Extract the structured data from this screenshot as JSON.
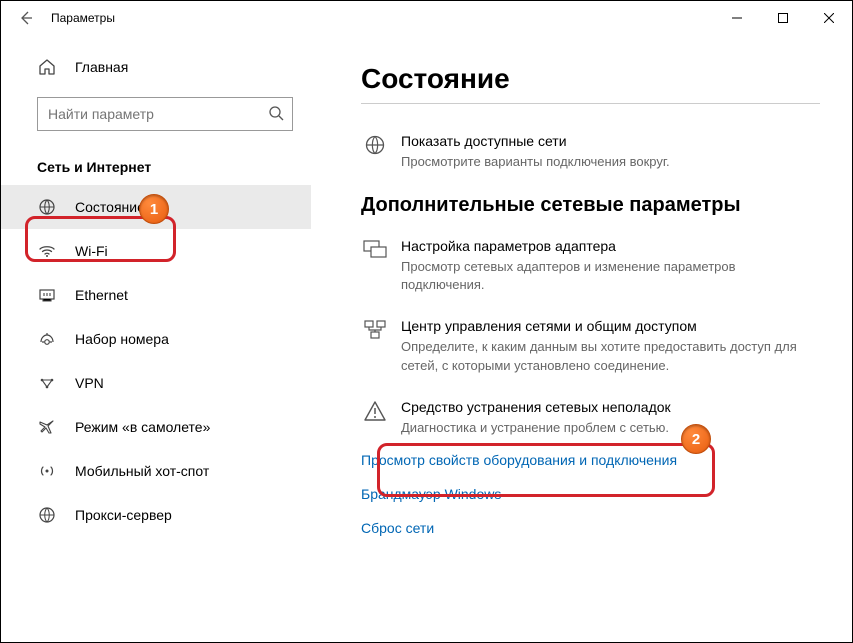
{
  "titlebar": {
    "title": "Параметры"
  },
  "sidebar": {
    "home": "Главная",
    "search_placeholder": "Найти параметр",
    "group": "Сеть и Интернет",
    "items": [
      {
        "label": "Состояние"
      },
      {
        "label": "Wi-Fi"
      },
      {
        "label": "Ethernet"
      },
      {
        "label": "Набор номера"
      },
      {
        "label": "VPN"
      },
      {
        "label": "Режим «в самолете»"
      },
      {
        "label": "Мобильный хот-спот"
      },
      {
        "label": "Прокси-сервер"
      }
    ]
  },
  "main": {
    "title": "Состояние",
    "row1_title": "Показать доступные сети",
    "row1_sub": "Просмотрите варианты подключения вокруг.",
    "section2": "Дополнительные сетевые параметры",
    "row2_title": "Настройка параметров адаптера",
    "row2_sub": "Просмотр сетевых адаптеров и изменение параметров подключения.",
    "row3_title": "Центр управления сетями и общим доступом",
    "row3_sub": "Определите, к каким данным вы хотите предоставить доступ для сетей, с которыми установлено соединение.",
    "row4_title": "Средство устранения сетевых неполадок",
    "row4_sub": "Диагностика и устранение проблем с сетью.",
    "link1": "Просмотр свойств оборудования и подключения",
    "link2": "Брандмауэр Windows",
    "link3": "Сброс сети"
  },
  "annotations": {
    "badge1": "1",
    "badge2": "2"
  }
}
